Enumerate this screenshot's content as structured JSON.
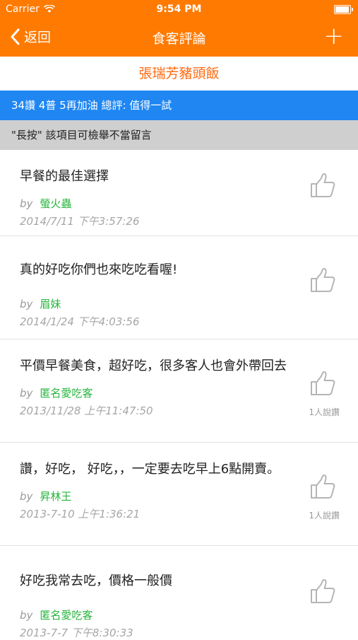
{
  "status": {
    "carrier": "Carrier",
    "time": "9:54 PM",
    "battery_level": 0.95
  },
  "nav": {
    "back_label": "返回",
    "title": "食客評論",
    "add_label": "+"
  },
  "restaurant": {
    "name": "張瑞芳豬頭飯"
  },
  "summary": {
    "text": "34讚 4普 5再加油 總評: 值得一試"
  },
  "notice": {
    "text": "\"長按\" 該項目可檢舉不當留言"
  },
  "reviews": [
    {
      "text": "早餐的最佳選擇",
      "by": "by",
      "author": "螢火蟲",
      "date": "2014/7/11 下午3:57:26",
      "likes": ""
    },
    {
      "text": "真的好吃你們也來吃吃看喔!",
      "by": "by",
      "author": "眉妹",
      "date": "2014/1/24 下午4:03:56",
      "likes": ""
    },
    {
      "text": "平價早餐美食，超好吃，很多客人也會外帶回去",
      "by": "by",
      "author": "匿名愛吃客",
      "date": "2013/11/28 上午11:47:50",
      "likes": "1人說讚"
    },
    {
      "text": "讚，好吃， 好吃，，一定要去吃早上6點開賣。",
      "by": "by",
      "author": "昇林王",
      "date": "2013-7-10 上午1:36:21",
      "likes": "1人說讚"
    },
    {
      "text": "好吃我常去吃，價格一般價",
      "by": "by",
      "author": "匿名愛吃客",
      "date": "2013-7-7 下午8:30:33",
      "likes": ""
    }
  ],
  "colors": {
    "accent": "#ff7a00",
    "summary_bg": "#1f86f2",
    "author": "#26b53c"
  }
}
